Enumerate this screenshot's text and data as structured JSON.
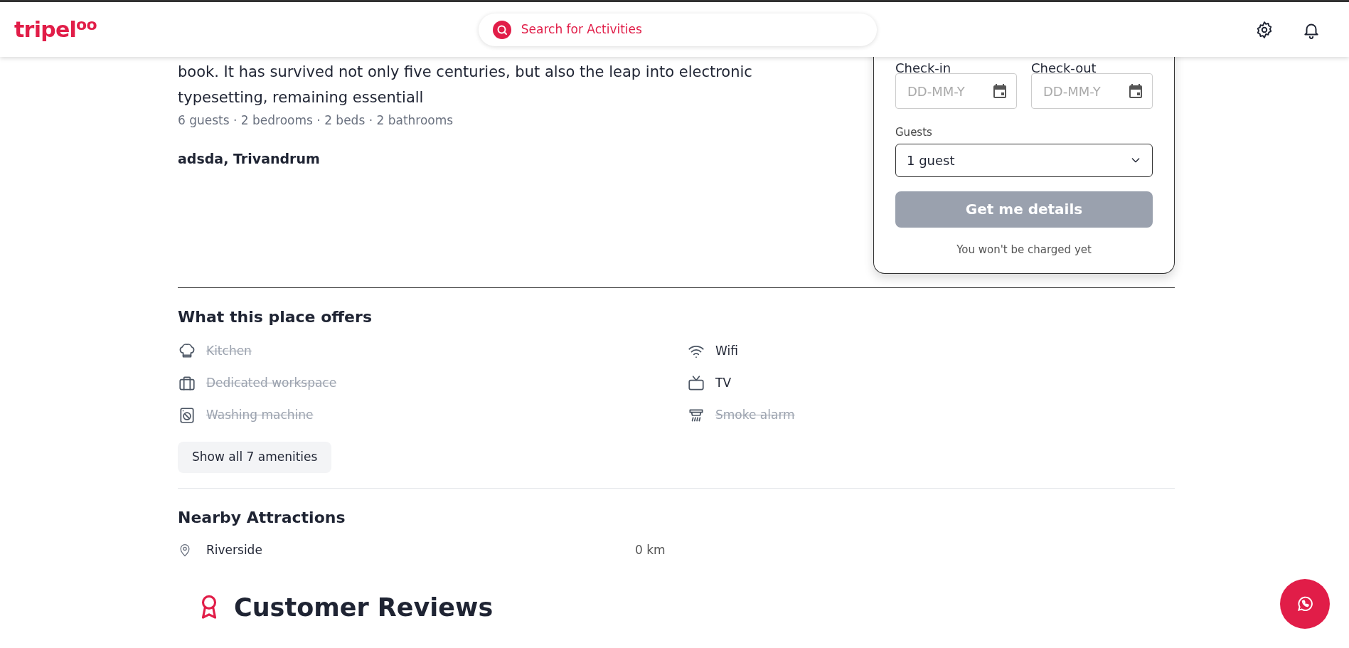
{
  "header": {
    "logo": "tripel",
    "logo_sup": "oo",
    "search": {
      "placeholder": "Search for Activities"
    }
  },
  "listing": {
    "description": "book. It has survived not only five centuries, but also the leap into electronic typesetting, remaining essentiall",
    "facts": "6 guests · 2 bedrooms · 2 beds · 2 bathrooms",
    "location": "adsda, Trivandrum"
  },
  "booking": {
    "checkin_label": "Check-in",
    "checkin_placeholder": "DD-MM-Y",
    "checkout_label": "Check-out",
    "checkout_placeholder": "DD-MM-Y",
    "guests_label": "Guests",
    "guests_value": "1 guest",
    "button": "Get me details",
    "button_disabled": true,
    "note": "You won't be charged yet"
  },
  "amenities": {
    "title": "What this place offers",
    "items": [
      {
        "label": "Kitchen",
        "available": false
      },
      {
        "label": "Wifi",
        "available": true
      },
      {
        "label": "Dedicated workspace",
        "available": false
      },
      {
        "label": "TV",
        "available": true
      },
      {
        "label": "Washing machine",
        "available": false
      },
      {
        "label": "Smoke alarm",
        "available": false
      }
    ],
    "show_all": "Show all 7 amenities"
  },
  "nearby": {
    "title": "Nearby Attractions",
    "items": [
      {
        "name": "Riverside",
        "distance": "0 km"
      }
    ]
  },
  "reviews": {
    "title": "Customer Reviews"
  }
}
